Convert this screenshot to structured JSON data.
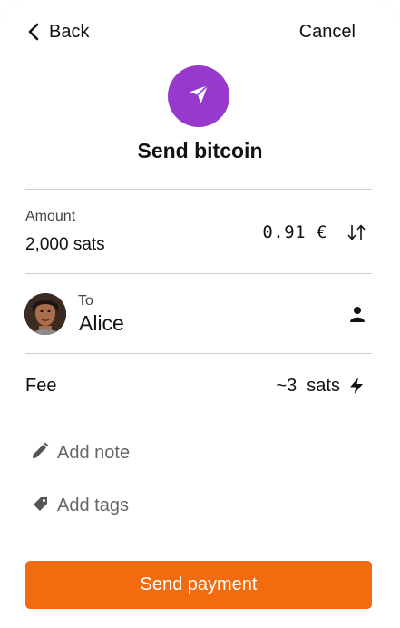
{
  "nav": {
    "back_label": "Back",
    "cancel_label": "Cancel"
  },
  "header": {
    "icon": "send-paper-plane-icon",
    "title": "Send bitcoin"
  },
  "amount": {
    "label": "Amount",
    "value": "2,000 sats",
    "fiat": "0.91 €",
    "swap_icon": "swap-arrows-icon"
  },
  "recipient": {
    "label": "To",
    "name": "Alice",
    "avatar": "contact-photo",
    "contact_icon": "person-icon"
  },
  "fee": {
    "label": "Fee",
    "value": "~3  sats",
    "icon": "lightning-bolt-icon"
  },
  "actions": {
    "note_label": "Add note",
    "note_icon": "pencil-icon",
    "tags_label": "Add tags",
    "tags_icon": "tag-icon"
  },
  "primary": {
    "label": "Send payment"
  },
  "colors": {
    "accent_purple": "#9639cc",
    "primary_orange": "#f26b0f",
    "divider": "#cfcfcf",
    "muted_text": "#666666"
  }
}
